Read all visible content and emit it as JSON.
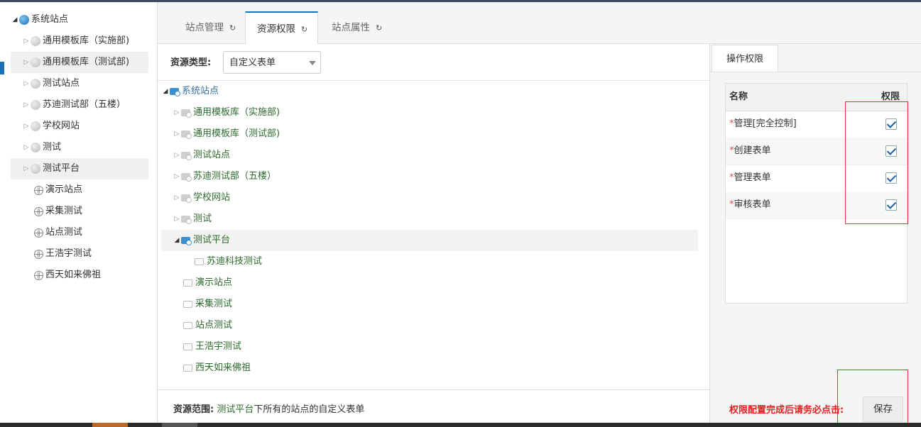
{
  "left_tree": {
    "root": "系统站点",
    "items": [
      {
        "label": "通用模板库（实施部)"
      },
      {
        "label": "通用模板库（测试部)"
      },
      {
        "label": "测试站点"
      },
      {
        "label": "苏迪测试部（五楼）"
      },
      {
        "label": "学校网站"
      },
      {
        "label": "测试"
      },
      {
        "label": "测试平台"
      },
      {
        "label": "演示站点"
      },
      {
        "label": "采集测试"
      },
      {
        "label": "站点测试"
      },
      {
        "label": "王浩宇测试"
      },
      {
        "label": "西天如来佛祖"
      }
    ]
  },
  "tabs": [
    {
      "label": "站点管理",
      "refresh_icon": "refresh-icon"
    },
    {
      "label": "资源权限",
      "refresh_icon": "refresh-icon"
    },
    {
      "label": "站点属性",
      "refresh_icon": "refresh-icon"
    }
  ],
  "resource": {
    "type_label": "资源类型:",
    "type_value": "自定义表单"
  },
  "center_tree": {
    "root": "系统站点",
    "items": [
      {
        "label": "通用模板库（实施部)"
      },
      {
        "label": "通用模板库（测试部)"
      },
      {
        "label": "测试站点"
      },
      {
        "label": "苏迪测试部（五楼）"
      },
      {
        "label": "学校网站"
      },
      {
        "label": "测试"
      },
      {
        "label": "测试平台"
      },
      {
        "label": "苏迪科技测试"
      },
      {
        "label": "演示站点"
      },
      {
        "label": "采集测试"
      },
      {
        "label": "站点测试"
      },
      {
        "label": "王浩宇测试"
      },
      {
        "label": "西天如来佛祖"
      }
    ]
  },
  "footer": {
    "scope_label": "资源范围:",
    "scope_site": "测试平台",
    "scope_suffix": "下所有的站点的自定义表单"
  },
  "permissions": {
    "tab_label": "操作权限",
    "col_name": "名称",
    "col_perm": "权限",
    "required_mark": "*",
    "rows": [
      {
        "name": "管理[完全控制]",
        "checked": true
      },
      {
        "name": "创建表单",
        "checked": true
      },
      {
        "name": "管理表单",
        "checked": true
      },
      {
        "name": "审核表单",
        "checked": true
      }
    ]
  },
  "save": {
    "hint": "权限配置完成后请务必点击:",
    "button_label": "保存"
  },
  "colors": {
    "accent": "#1a73b8",
    "tree_text": "#2d6a2d",
    "highlight_red": "#e53333"
  }
}
